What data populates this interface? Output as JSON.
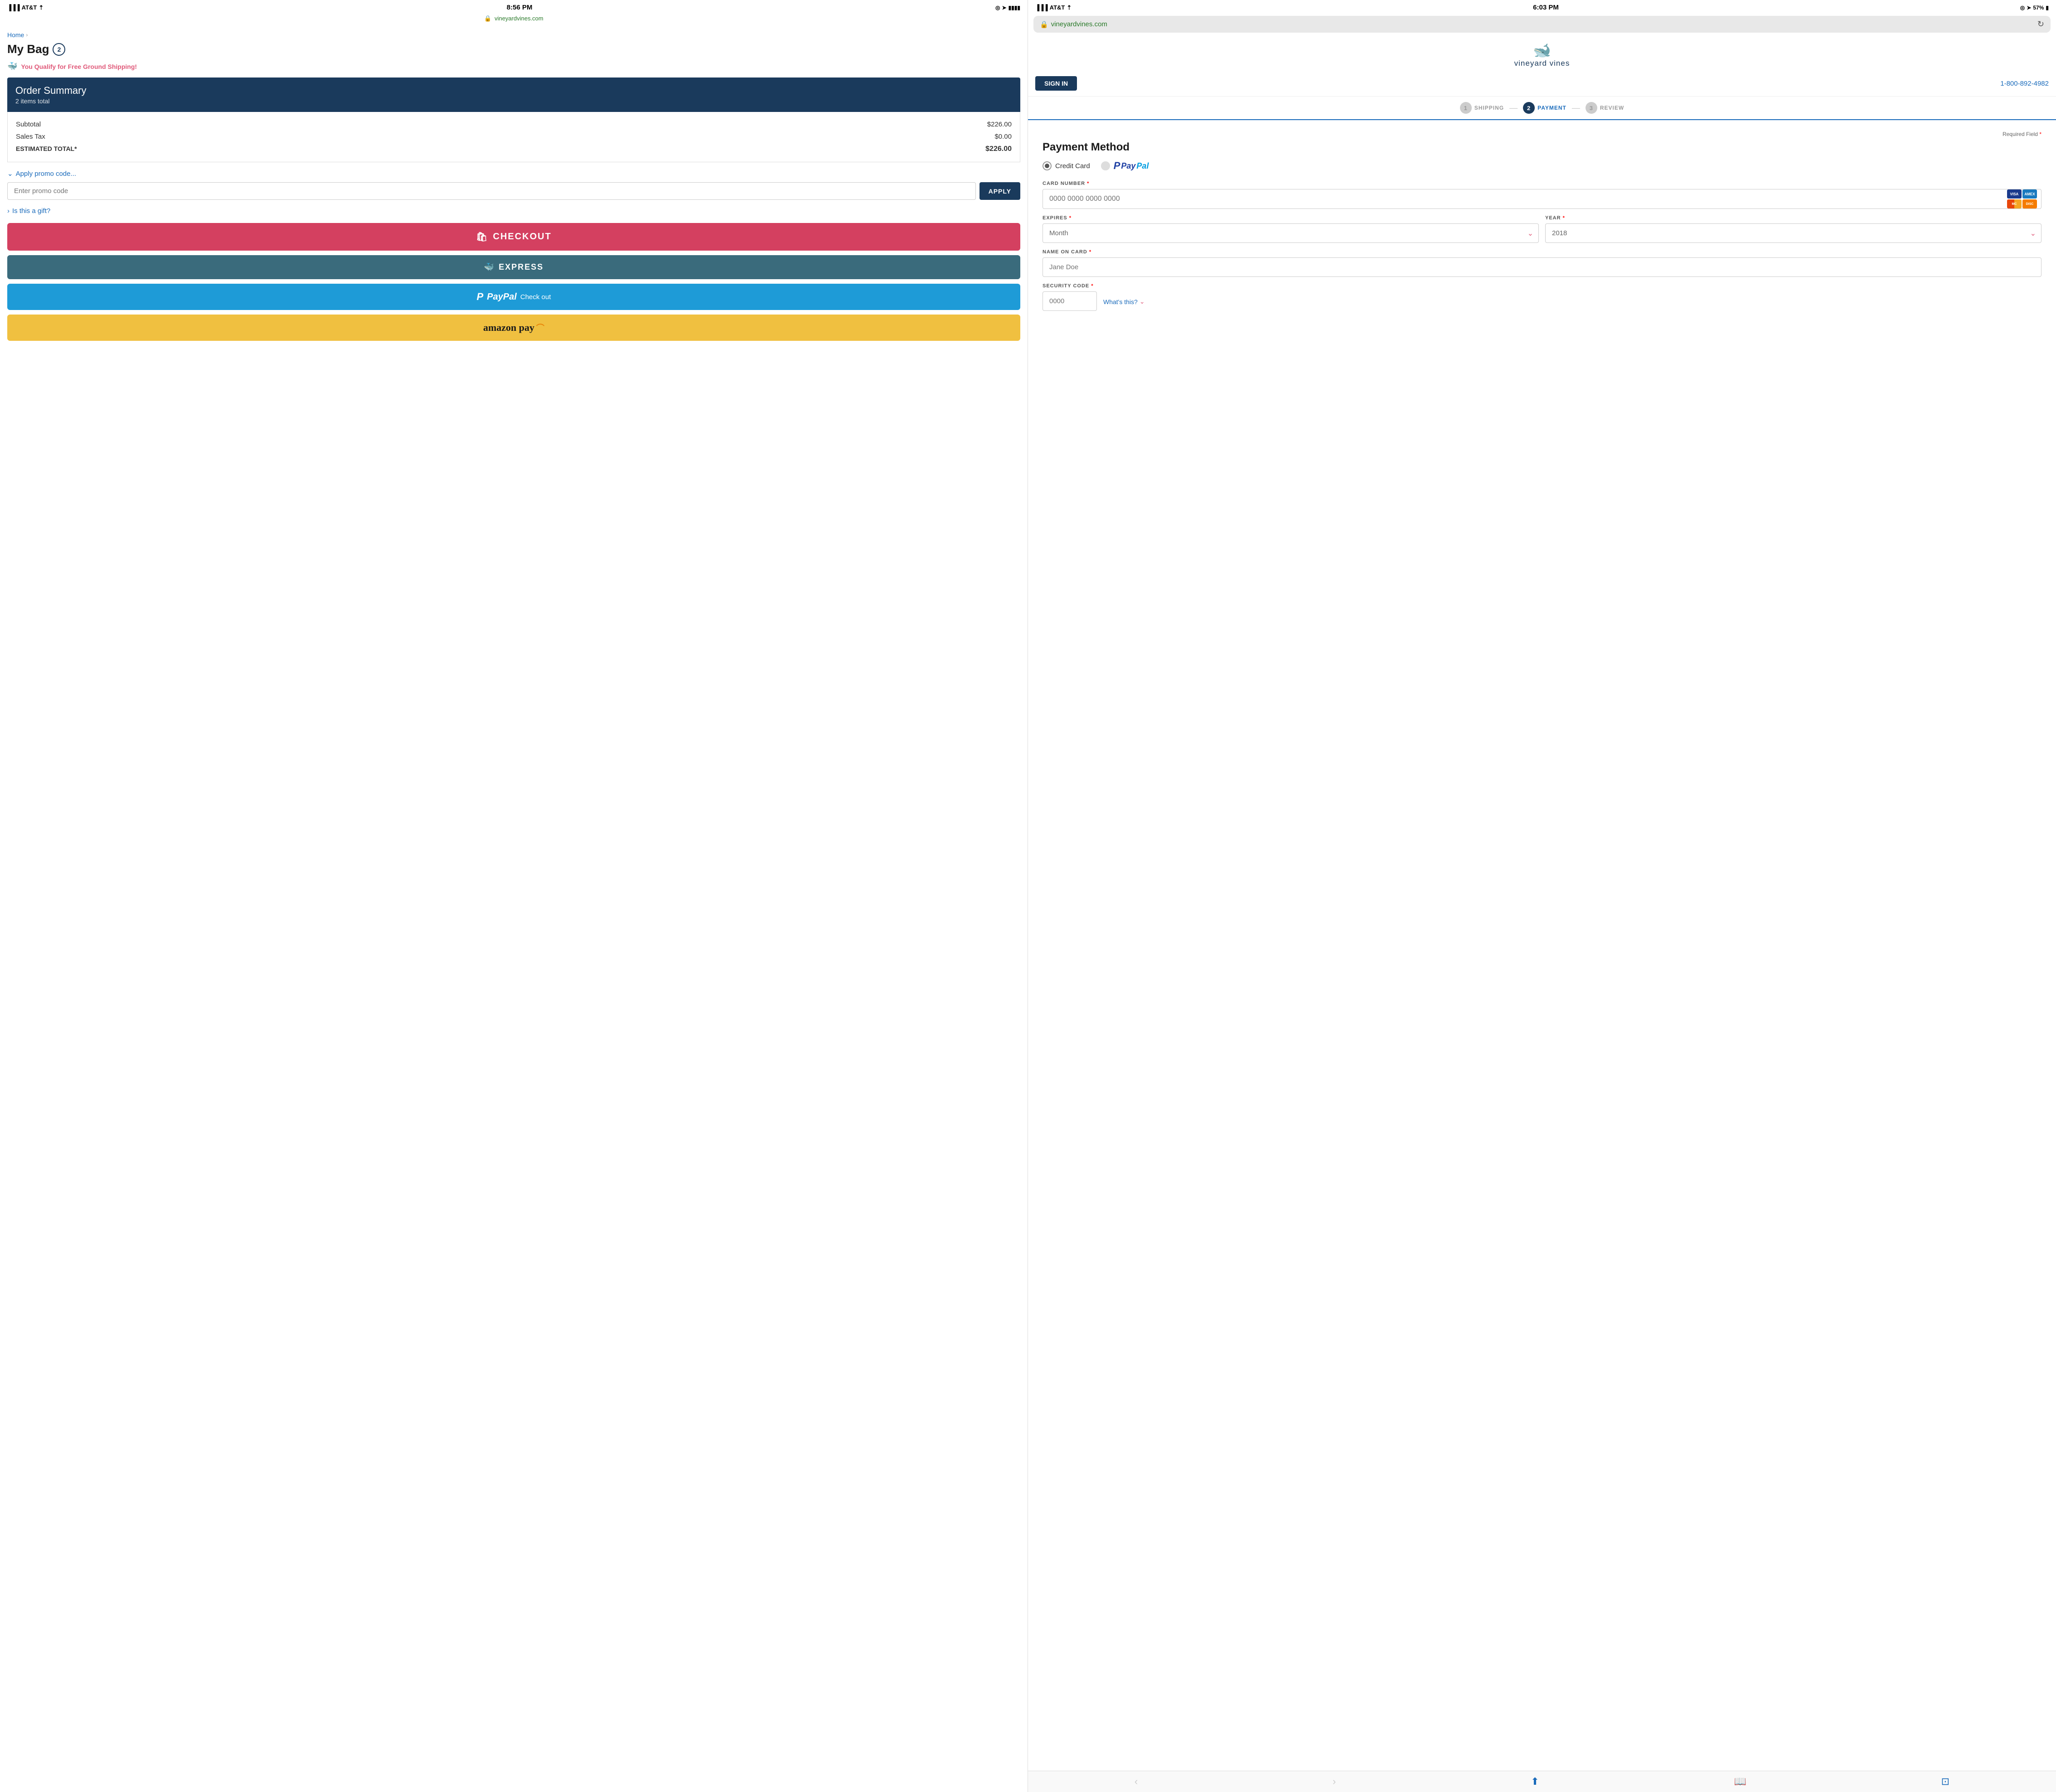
{
  "left_phone": {
    "status_bar": {
      "carrier": "AT&T",
      "wifi": "WiFi",
      "time": "8:56 PM",
      "battery": "Full"
    },
    "url": "vineyardvines.com",
    "breadcrumb": "Home",
    "page_title": "My Bag",
    "bag_count": "2",
    "shipping_notice": "You Qualify for Free Ground Shipping!",
    "order_summary": {
      "title": "Order Summary",
      "subtitle": "2 items total",
      "subtotal_label": "Subtotal",
      "subtotal_value": "$226.00",
      "tax_label": "Sales Tax",
      "tax_value": "$0.00",
      "total_label": "ESTIMATED TOTAL*",
      "total_value": "$226.00"
    },
    "promo": {
      "toggle_label": "Apply promo code...",
      "input_placeholder": "Enter promo code",
      "button_label": "APPLY"
    },
    "gift": {
      "toggle_label": "Is this a gift?"
    },
    "buttons": {
      "checkout": "CHECKOUT",
      "express": "EXPRESS",
      "paypal": "PayPal",
      "paypal_checkout": "Check out",
      "amazon": "amazon pay"
    }
  },
  "right_phone": {
    "status_bar": {
      "carrier": "AT&T",
      "wifi": "WiFi",
      "time": "6:03 PM",
      "battery": "57%"
    },
    "url": "vineyardvines.com",
    "brand_name": "vineyard vines",
    "sign_in_button": "SIGN IN",
    "phone_number": "1-800-892-4982",
    "steps": [
      {
        "number": "1",
        "label": "SHIPPING",
        "state": "inactive"
      },
      {
        "number": "2",
        "label": "PAYMENT",
        "state": "active"
      },
      {
        "number": "3",
        "label": "REVIEW",
        "state": "inactive"
      }
    ],
    "required_field": "Required Field",
    "payment": {
      "title": "Payment Method",
      "credit_card_label": "Credit Card",
      "paypal_label": "PayPal",
      "card_number_label": "CARD NUMBER",
      "card_number_asterisk": "*",
      "card_number_placeholder": "0000 0000 0000 0000",
      "expires_label": "EXPIRES",
      "expires_asterisk": "*",
      "month_placeholder": "Month",
      "year_label": "YEAR",
      "year_asterisk": "*",
      "year_value": "2018",
      "name_label": "NAME ON CARD",
      "name_asterisk": "*",
      "name_placeholder": "Jane Doe",
      "security_label": "SECURITY CODE",
      "security_asterisk": "*",
      "security_placeholder": "0000",
      "whats_this": "What's this?"
    }
  }
}
